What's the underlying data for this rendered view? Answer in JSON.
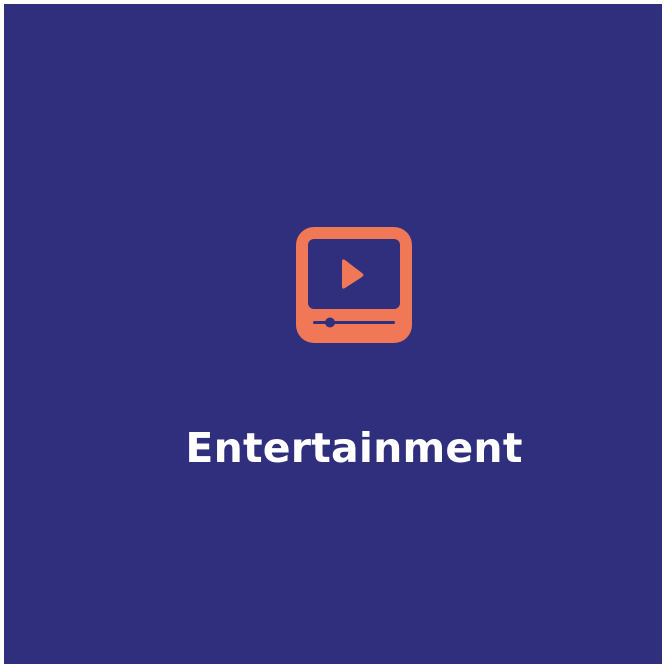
{
  "card": {
    "title": "Entertainment",
    "icon": "video-player-icon",
    "background_color": "#2f2f7e",
    "icon_color": "#f07856",
    "text_color": "#ffffff"
  }
}
